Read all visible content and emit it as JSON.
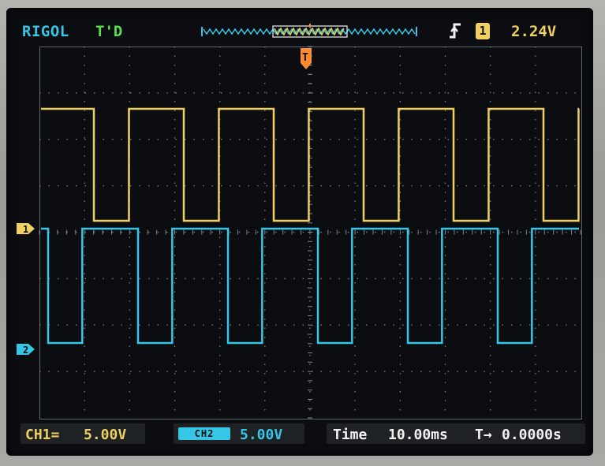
{
  "header": {
    "brand": "RIGOL",
    "status": "T'D",
    "trigger_source": "1",
    "trigger_level": "2.24V",
    "trigger_edge_icon": "rising-edge-icon"
  },
  "markers": {
    "ch1": "1",
    "ch2": "2",
    "trigger_pos": "T"
  },
  "footer": {
    "ch1_label": "CH1=",
    "ch1_scale": "5.00V",
    "ch2_label": "CH2",
    "ch2_scale": "5.00V",
    "time_label": "Time",
    "time_scale": "10.00ms",
    "offset_label": "T→",
    "offset_value": "0.0000s"
  },
  "colors": {
    "ch1": "#f0d060",
    "ch2": "#36c6e6",
    "status": "#58e04a",
    "grid": "#6a7a80"
  }
}
